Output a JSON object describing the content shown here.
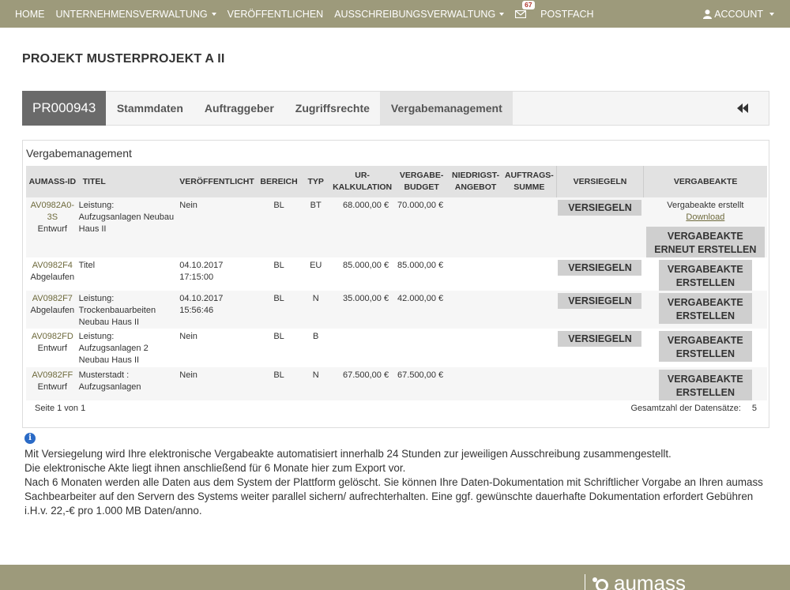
{
  "nav": {
    "home": "HOME",
    "unternehmen": "UNTERNEHMENSVERWALTUNG",
    "veroeffentlichen": "VERÖFFENTLICHEN",
    "ausschreibung": "AUSSCHREIBUNGSVERWALTUNG",
    "mail_badge": "67",
    "postfach": "POSTFACH",
    "account": "ACCOUNT"
  },
  "page_title": "PROJEKT MUSTERPROJEKT A II",
  "tabs": {
    "project_id": "PR000943",
    "items": [
      "Stammdaten",
      "Auftraggeber",
      "Zugriffsrechte",
      "Vergabemanagement"
    ],
    "active": "Vergabemanagement"
  },
  "panel": {
    "title": "Vergabemanagement",
    "columns": [
      "AUMASS-ID",
      "TITEL",
      "VERÖFFENTLICHT",
      "BEREICH",
      "TYP",
      "UR-",
      "KALKULATION",
      "VERGABE-",
      "BUDGET",
      "NIEDRIGST-",
      "ANGEBOT",
      "AUFTRAGS-",
      "SUMME",
      "VERSIEGELN",
      "VERGABEAKTE"
    ],
    "rows": [
      {
        "id": "AV0982A0-3S",
        "status": "Entwurf",
        "titel1": "Leistung:",
        "titel2": "Aufzugsanlagen Neubau",
        "titel3": "Haus II",
        "date1": "Nein",
        "date2": "",
        "bereich": "BL",
        "typ": "BT",
        "ur": "68.000,00 €",
        "budget": "70.000,00 €",
        "versiegeln": "VERSIEGELN",
        "erstellt": "Vergabeakte erstellt",
        "download": "Download",
        "va1": "VERGABEAKTE",
        "va2": "ERNEUT ERSTELLEN"
      },
      {
        "id": "AV0982F4",
        "status": "Abgelaufen",
        "titel1": "Titel",
        "titel2": "",
        "titel3": "",
        "date1": "04.10.2017",
        "date2": "17:15:00",
        "bereich": "BL",
        "typ": "EU",
        "ur": "85.000,00 €",
        "budget": "85.000,00 €",
        "versiegeln": "VERSIEGELN",
        "va1": "VERGABEAKTE",
        "va2": "ERSTELLEN"
      },
      {
        "id": "AV0982F7",
        "status": "Abgelaufen",
        "titel1": "Leistung:",
        "titel2": "Trockenbauarbeiten",
        "titel3": "Neubau Haus II",
        "date1": "04.10.2017",
        "date2": "15:56:46",
        "bereich": "BL",
        "typ": "N",
        "ur": "35.000,00 €",
        "budget": "42.000,00 €",
        "versiegeln": "VERSIEGELN",
        "va1": "VERGABEAKTE",
        "va2": "ERSTELLEN"
      },
      {
        "id": "AV0982FD",
        "status": "Entwurf",
        "titel1": "Leistung:",
        "titel2": "Aufzugsanlagen 2",
        "titel3": "Neubau Haus II",
        "date1": "Nein",
        "date2": "",
        "bereich": "BL",
        "typ": "B",
        "ur": "",
        "budget": "",
        "versiegeln": "VERSIEGELN",
        "va1": "VERGABEAKTE",
        "va2": "ERSTELLEN"
      },
      {
        "id": "AV0982FF",
        "status": "Entwurf",
        "titel1": "Musterstadt :",
        "titel2": "Aufzugsanlagen",
        "titel3": "",
        "date1": "Nein",
        "date2": "",
        "bereich": "BL",
        "typ": "N",
        "ur": "67.500,00 €",
        "budget": "67.500,00 €",
        "va1": "VERGABEAKTE",
        "va2": "ERSTELLEN"
      }
    ],
    "pager_left": "Seite 1 von 1",
    "pager_right_label": "Gesamtzahl der Datensätze:",
    "pager_right_value": "5"
  },
  "info": {
    "line1": "Mit Versiegelung wird Ihre elektronische Vergabeakte automatisiert innerhalb 24 Stunden zur jeweiligen Ausschreibung zusammengestellt.",
    "line2": "Die elektronische Akte liegt ihnen anschließend für 6 Monate hier zum Export vor.",
    "line3": "Nach 6 Monaten werden alle Daten aus dem System der Plattform gelöscht. Sie können Ihre Daten-Dokumentation mit Schriftlicher Vorgabe an Ihren aumass Sachbearbeiter auf den Servern des Systems weiter parallel sichern/ aufrechterhalten. Eine ggf. gewünschte dauerhafte Dokumentation erfordert Gebühren i.H.v. 22,-€ pro 1.000 MB Daten/anno."
  },
  "footer": {
    "logo": "aumass"
  },
  "colors": {
    "nav_bg": "#9d9a7b",
    "link": "#6e6a3c",
    "info_icon": "#2a6ac6"
  }
}
